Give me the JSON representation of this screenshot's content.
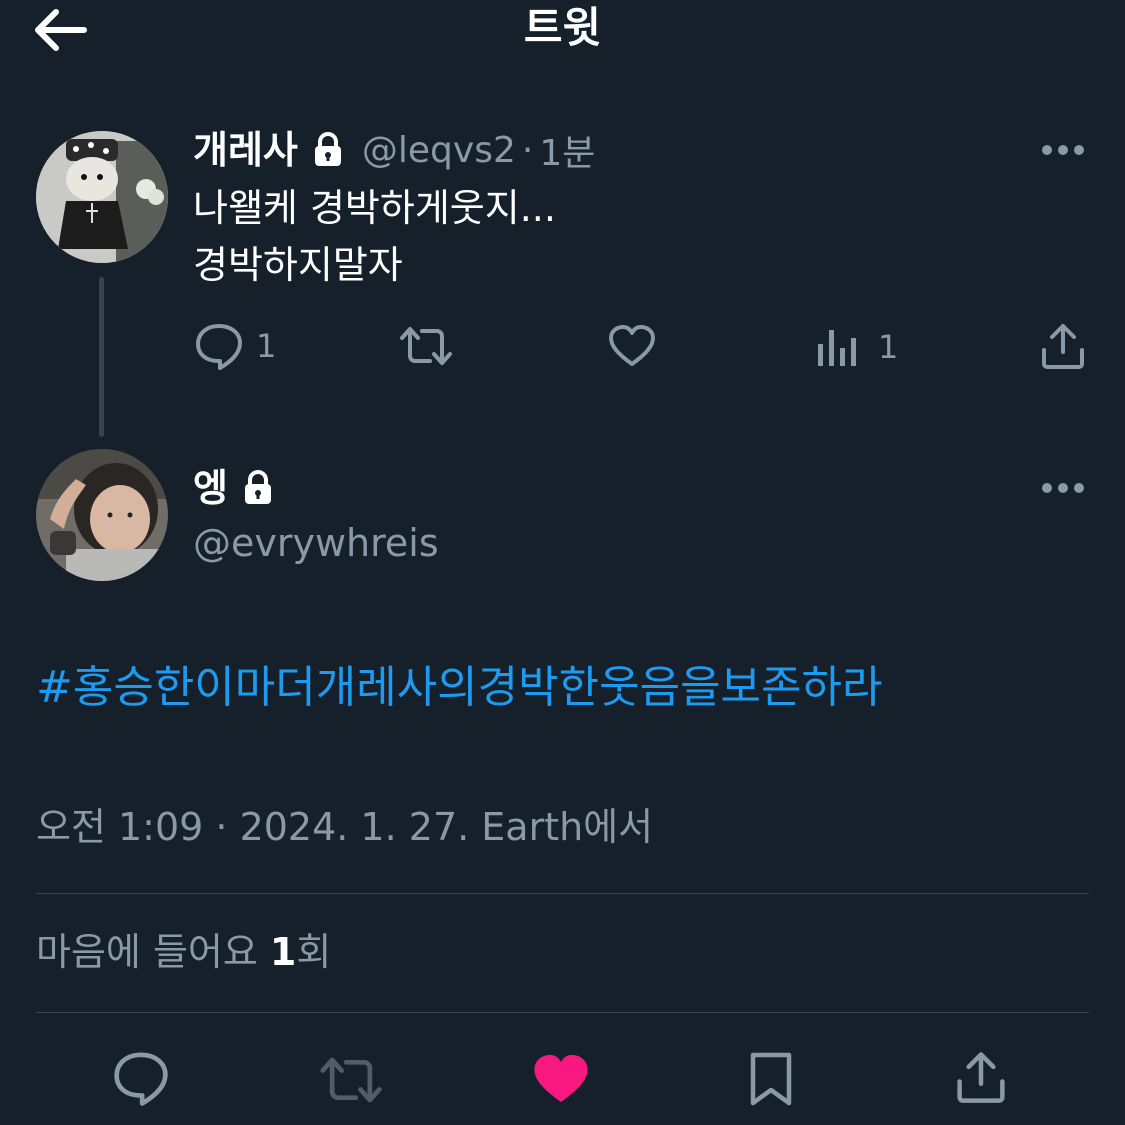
{
  "header": {
    "title": "트윗",
    "back_icon": "arrow-left-icon"
  },
  "parent_tweet": {
    "display_name": "개레사",
    "handle": "@leqvs2",
    "time": "1분",
    "separator": "·",
    "text_line1": "나왤케 경박하게웃지...",
    "text_line2": "경박하지말자",
    "reply_count": "1",
    "views_count": "1",
    "protected": true
  },
  "main_tweet": {
    "display_name": "엥",
    "handle": "@evrywhreis",
    "hashtag": "#홍승한이마더개레사의경박한웃음을보존하라",
    "timestamp": "오전 1:09 · 2024. 1. 27. Earth에서",
    "likes_prefix": "마음에 들어요 ",
    "likes_count": "1",
    "likes_suffix": "회",
    "protected": true
  },
  "colors": {
    "background": "#15202b",
    "muted": "#8b98a5",
    "link": "#1d9bf0",
    "like_active": "#f91880",
    "divider": "#38444d"
  },
  "icons": [
    "arrow-left-icon",
    "lock-icon",
    "more-icon",
    "reply-icon",
    "retweet-icon",
    "heart-icon",
    "views-icon",
    "share-icon",
    "bookmark-icon"
  ]
}
